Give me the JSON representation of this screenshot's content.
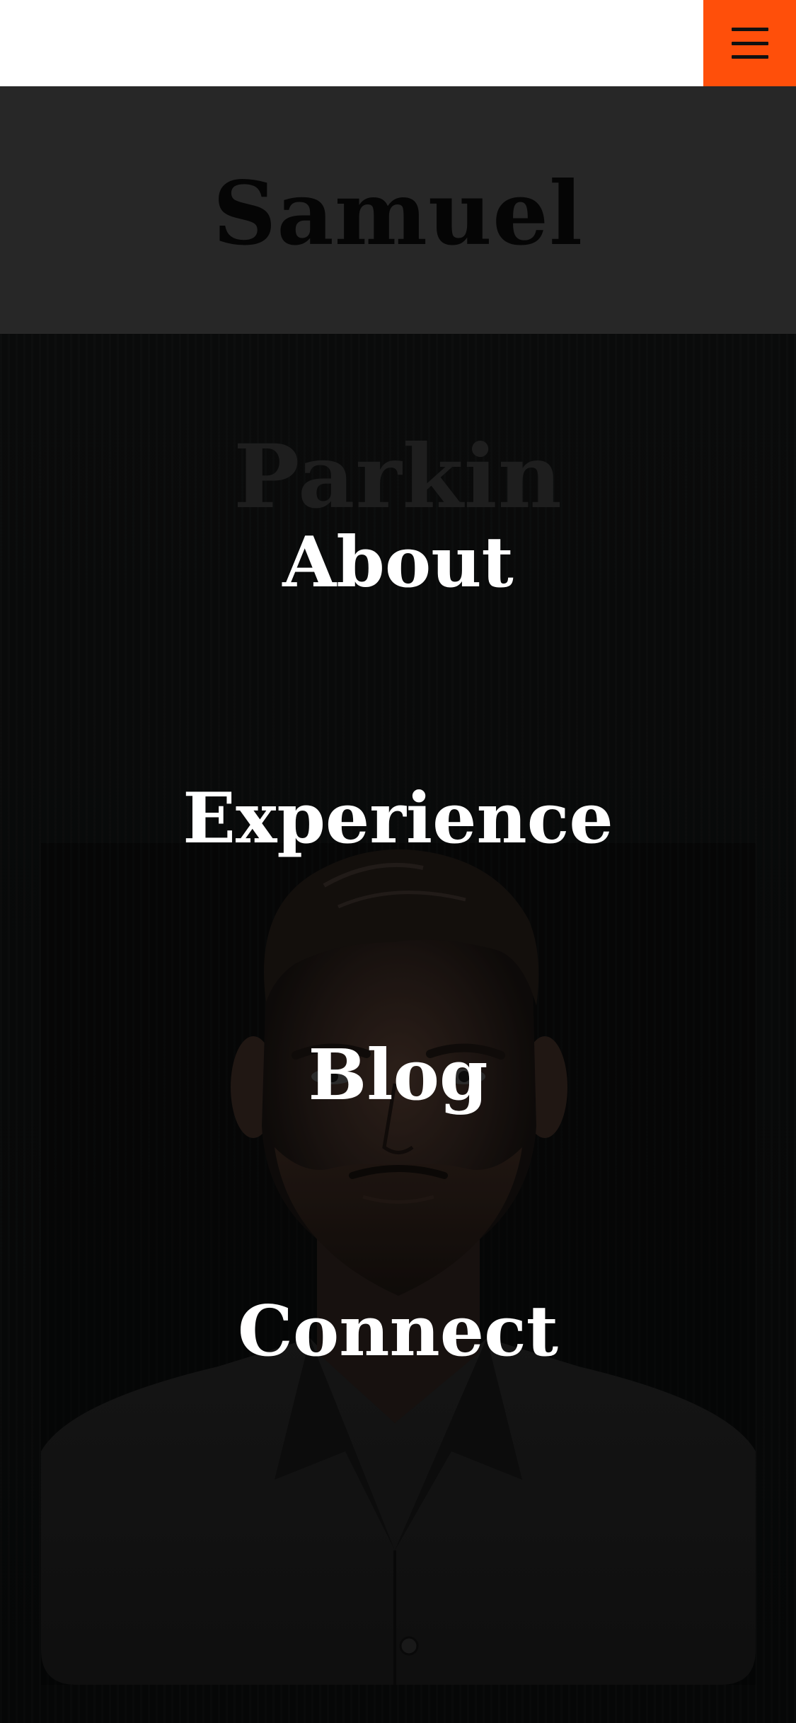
{
  "header": {
    "menu_icon": "hamburger-menu-icon",
    "first_name": "Samuel",
    "last_name": "Parkin"
  },
  "nav": {
    "items": [
      {
        "label": "About"
      },
      {
        "label": "Experience"
      },
      {
        "label": "Blog"
      },
      {
        "label": "Connect"
      }
    ]
  },
  "colors": {
    "accent": "#ff4f0a",
    "name_band": "#272727",
    "background": "#060606",
    "nav_text": "#ffffff"
  }
}
